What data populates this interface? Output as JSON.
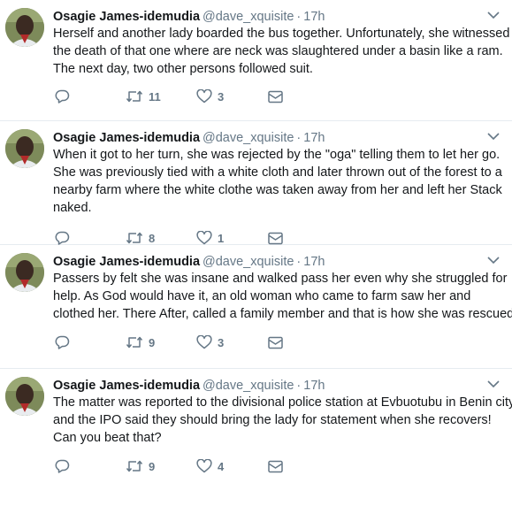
{
  "colors": {
    "text": "#14171a",
    "muted": "#657786",
    "divider": "#e6ecf0"
  },
  "icons": {
    "reply": "reply-icon",
    "retweet": "retweet-icon",
    "like": "heart-icon",
    "dm": "envelope-icon",
    "caret": "chevron-down-icon"
  },
  "tweets": [
    {
      "name": "Osagie James-idemudia",
      "handle": "@dave_xquisite",
      "dot": "·",
      "time": "17h",
      "lines": [
        "Herself and another lady boarded the bus together. Unfortunately, she witnessed",
        "the death of that one where are neck was slaughtered under a basin like a ram.",
        "The next day, two other persons followed suit."
      ],
      "retweets": "11",
      "likes": "3"
    },
    {
      "name": "Osagie James-idemudia",
      "handle": "@dave_xquisite",
      "dot": "·",
      "time": "17h",
      "lines": [
        "When it got to her turn, she was rejected by the \"oga\" telling them to let her go.",
        "She was previously tied with a white cloth and later thrown out of the forest to a",
        "nearby farm where the white clothe was taken away from her and left her Stack",
        "naked."
      ],
      "retweets": "8",
      "likes": "1"
    },
    {
      "name": "Osagie James-idemudia",
      "handle": "@dave_xquisite",
      "dot": "·",
      "time": "17h",
      "lines": [
        "Passers by felt she was insane and walked pass her even why she struggled for",
        "help. As God would have it,  an old woman who came to farm saw her and",
        "clothed her. There After, called a family member and that is how she was rescued"
      ],
      "retweets": "9",
      "likes": "3"
    },
    {
      "name": "Osagie James-idemudia",
      "handle": "@dave_xquisite",
      "dot": "·",
      "time": "17h",
      "lines": [
        "The matter was reported to the divisional police station at Evbuotubu in Benin city",
        "and the IPO said they should bring the lady for statement when she recovers!",
        "Can you beat that?"
      ],
      "retweets": "9",
      "likes": "4"
    }
  ]
}
